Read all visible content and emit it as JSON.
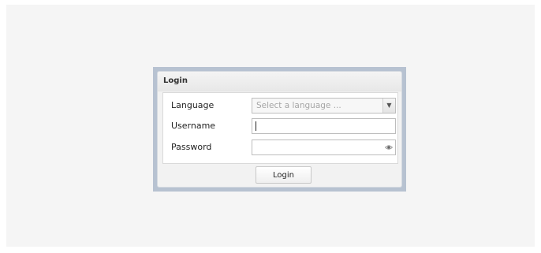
{
  "login_panel": {
    "title": "Login"
  },
  "fields": {
    "language": {
      "label": "Language",
      "placeholder": "Select a language ..."
    },
    "username": {
      "label": "Username",
      "value": ""
    },
    "password": {
      "label": "Password",
      "value": ""
    }
  },
  "buttons": {
    "login_label": "Login"
  },
  "icons": {
    "dropdown": "chevron-down-icon",
    "password_toggle": "eye-icon"
  },
  "colors": {
    "frame_border": "#b7c2d1",
    "page_background": "#f5f5f5"
  }
}
